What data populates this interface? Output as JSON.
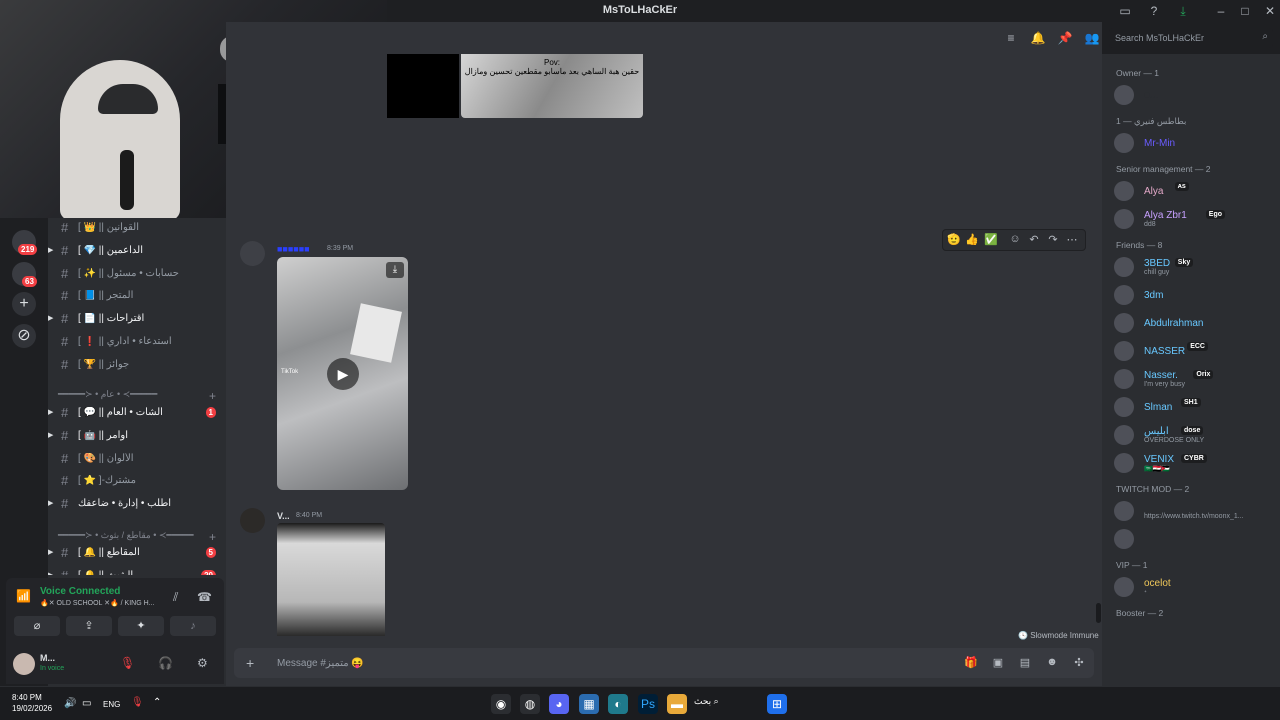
{
  "window": {
    "title": "MsToLHaCkEr"
  },
  "server_rail": {
    "badges": [
      "219",
      "63"
    ]
  },
  "channels": [
    {
      "name": "[ 👑 || القوانين",
      "arrow": false,
      "muted": true
    },
    {
      "name": "[ 💎 || الداعمين",
      "arrow": true,
      "muted": false
    },
    {
      "name": "[ ✨ || حسابات • مسئول",
      "arrow": false,
      "muted": true
    },
    {
      "name": "[ 📘 || المتجر",
      "arrow": false,
      "muted": true
    },
    {
      "name": "[ 📄 || اقتراحات",
      "arrow": true,
      "muted": false
    },
    {
      "name": "[ ❗ || استدعاء • اداري",
      "arrow": false,
      "muted": true
    },
    {
      "name": "[ 🏆 || جوائز",
      "arrow": false,
      "muted": true
    }
  ],
  "category1": "━━━━━≻ • عام • ≺━━━━━",
  "channels2": [
    {
      "name": "[ 💬 || الشات • العام",
      "arrow": true,
      "badge": "1"
    },
    {
      "name": "[ 🤖 || اوامر",
      "arrow": true,
      "badge": ""
    },
    {
      "name": "[ 🎨 || الألوان",
      "arrow": false,
      "badge": ""
    },
    {
      "name": "[ ⭐ ]-مشترك",
      "arrow": false,
      "badge": ""
    },
    {
      "name": "أطلب • إدارة • ضاعفك",
      "arrow": true,
      "badge": ""
    }
  ],
  "category2": "━━━━━≻ • مقاطع / بثوث • ≺━━━━━",
  "channels3": [
    {
      "name": "[ 🔔 || المقاطع",
      "arrow": true,
      "badge": "5"
    },
    {
      "name": "[ 🔔 || البثوث",
      "arrow": true,
      "badge": "20"
    }
  ],
  "voice": {
    "status": "Voice Connected",
    "channel": "🔥✕ OLD SCHOOL ✕🔥 / KING H..."
  },
  "user": {
    "name": "M...",
    "status": "In voice"
  },
  "chat": {
    "top_image_caption": "Pov:",
    "top_image_text": "حقين هبة الساهي بعد ماسابو مقطعين تحسين ومازال",
    "msg1": {
      "author": "■■■■■■",
      "time": "8:39 PM",
      "tiktok": "TikTok"
    },
    "msg2": {
      "author": "V...",
      "time": "8:40 PM"
    },
    "slowmode": "Slowmode Immune",
    "composer_placeholder": "Message #متميز 😝"
  },
  "search": {
    "placeholder": "Search MsToLHaCkEr"
  },
  "members": {
    "groups": [
      {
        "title": "Owner — 1",
        "rows": [
          {
            "name": "■...",
            "sub": "",
            "tag": "",
            "color": "#2b2d31"
          }
        ]
      },
      {
        "title": "بطاطس فنيري — 1",
        "rows": [
          {
            "name": "Mr-Min",
            "sub": "",
            "tag": "",
            "color": "#6a5cff"
          }
        ]
      },
      {
        "title": "Senior management — 2",
        "rows": [
          {
            "name": "Alya",
            "sub": "",
            "tag": "ᴀs",
            "color": "#e3a8c8"
          },
          {
            "name": "Alya Zbr1",
            "sub": "dd8",
            "tag": "Ego",
            "color": "#c7a0ff"
          }
        ]
      },
      {
        "title": "Friends — 8",
        "rows": [
          {
            "name": "3BED",
            "sub": "chill guy",
            "tag": "Sky",
            "color": "#68c8ff"
          },
          {
            "name": "3dm",
            "sub": "",
            "tag": "",
            "color": "#68c8ff"
          },
          {
            "name": "Abdulrahman",
            "sub": "",
            "tag": "",
            "color": "#68c8ff"
          },
          {
            "name": "NASSER",
            "sub": "",
            "tag": "ECC",
            "color": "#68c8ff"
          },
          {
            "name": "Nasser.",
            "sub": "I'm very busy",
            "tag": "Orix",
            "color": "#68c8ff"
          },
          {
            "name": "Slman",
            "sub": "",
            "tag": "SH1",
            "color": "#68c8ff"
          },
          {
            "name": "ابليس",
            "sub": "OVERDOSE ONLY",
            "tag": "dose",
            "color": "#68c8ff"
          },
          {
            "name": "VENIX",
            "sub": "⁠🇸🇦🇪🇬🇯🇴",
            "tag": "CYBR",
            "color": "#68c8ff"
          }
        ]
      },
      {
        "title": "TWITCH MOD — 2",
        "rows": [
          {
            "name": "",
            "sub": "https://www.twitch.tv/moonx_1...",
            "tag": "",
            "color": "#dbdee1"
          },
          {
            "name": "",
            "sub": "",
            "tag": "",
            "color": "#dbdee1"
          }
        ]
      },
      {
        "title": "VIP — 1",
        "rows": [
          {
            "name": "ocelot",
            "sub": "ᐩ",
            "tag": "",
            "color": "#f0c85a"
          }
        ]
      },
      {
        "title": "Booster — 2",
        "rows": []
      }
    ]
  },
  "taskbar": {
    "time": "8:40 PM",
    "date": "19/02/2026",
    "lang": "ENG",
    "search": "بحث"
  },
  "colors": {
    "accent": "#5865f2",
    "online": "#23a55a",
    "dnd": "#f23f43",
    "bg": "#313338"
  }
}
